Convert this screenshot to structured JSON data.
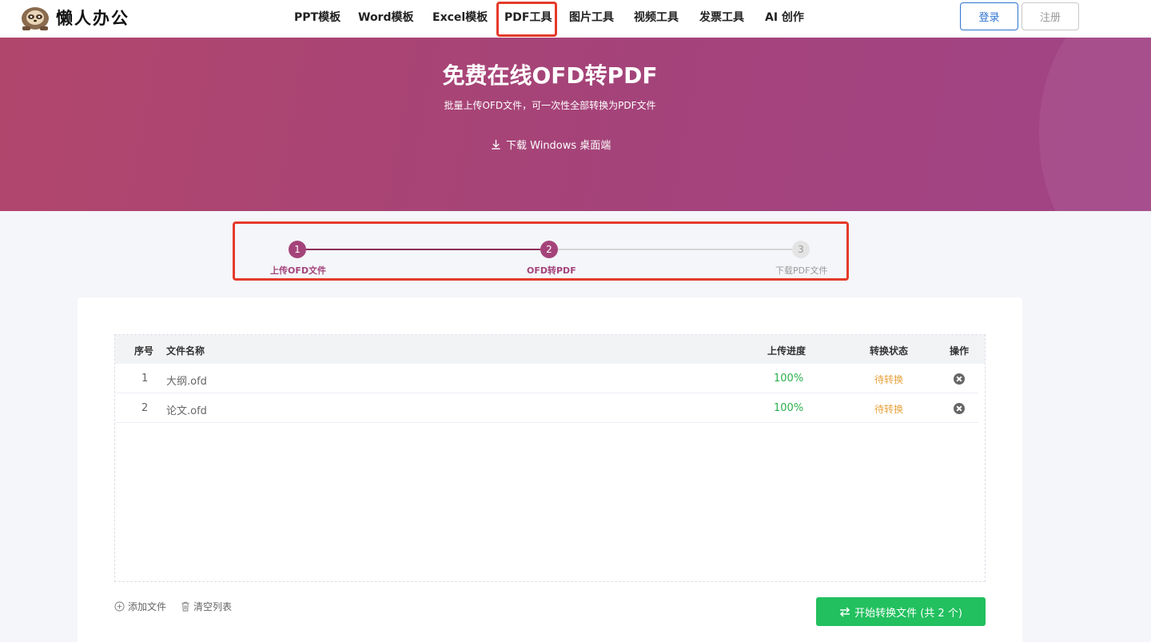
{
  "brand": {
    "name": "懒人办公",
    "logo_icon": "sloth-icon"
  },
  "nav": {
    "items": [
      {
        "label": "PPT模板"
      },
      {
        "label": "Word模板"
      },
      {
        "label": "Excel模板"
      },
      {
        "label": "PDF工具"
      },
      {
        "label": "图片工具"
      },
      {
        "label": "视频工具"
      },
      {
        "label": "发票工具"
      },
      {
        "label": "AI 创作"
      }
    ],
    "active": "PDF工具"
  },
  "auth": {
    "login": "登录",
    "register": "注册"
  },
  "banner": {
    "title": "免费在线OFD转PDF",
    "subtitle": "批量上传OFD文件，可一次性全部转换为PDF文件",
    "download": "下载 Windows 桌面端"
  },
  "steps": [
    {
      "num": "1",
      "label": "上传OFD文件",
      "state": "done"
    },
    {
      "num": "2",
      "label": "OFD转PDF",
      "state": "active"
    },
    {
      "num": "3",
      "label": "下载PDF文件",
      "state": "pending"
    }
  ],
  "table": {
    "headers": {
      "index": "序号",
      "name": "文件名称",
      "progress": "上传进度",
      "status": "转换状态",
      "action": "操作"
    },
    "rows": [
      {
        "index": "1",
        "name": "大纲.ofd",
        "progress": "100%",
        "status": "待转换"
      },
      {
        "index": "2",
        "name": "论文.ofd",
        "progress": "100%",
        "status": "待转换"
      }
    ]
  },
  "actions": {
    "add_file": "添加文件",
    "clear_list": "清空列表",
    "start": "开始转换文件 (共 2 个)"
  },
  "colors": {
    "brand": "#a4437a",
    "progress_green": "#2bb04e",
    "status_orange": "#e6a23c",
    "start_button": "#22c05f",
    "login_blue": "#2f74d0",
    "step_pending": "#d6d6d6"
  }
}
